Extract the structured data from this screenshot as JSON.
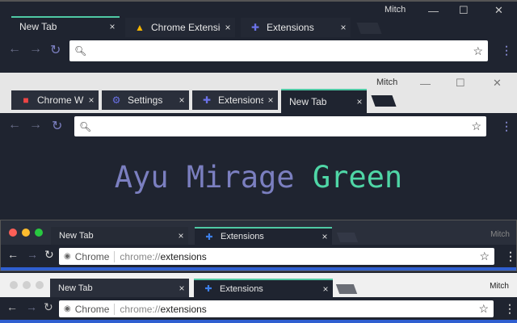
{
  "colors": {
    "frame_dark": "#1f2430",
    "accent_green": "#4fd6a6",
    "accent_purple": "#7b7fc0",
    "blue_strip": "#2f5fd0"
  },
  "window1": {
    "user": "Mitch",
    "tabs": [
      {
        "label": "New Tab",
        "icon": "none"
      },
      {
        "label": "Chrome Extension",
        "icon": "google-drive-icon"
      },
      {
        "label": "Extensions",
        "icon": "puzzle-icon"
      }
    ],
    "close": "×"
  },
  "window2": {
    "user": "Mitch",
    "tabs": [
      {
        "label": "Chrome W",
        "icon": "web-store-icon"
      },
      {
        "label": "Settings",
        "icon": "gear-icon"
      },
      {
        "label": "Extensions",
        "icon": "puzzle-icon"
      },
      {
        "label": "New Tab",
        "icon": "none"
      }
    ],
    "close": "×",
    "headline_a": "Ayu Mirage",
    "headline_b": "Green"
  },
  "window3": {
    "user": "Mitch",
    "tabs": [
      {
        "label": "New Tab"
      },
      {
        "label": "Extensions",
        "icon": "puzzle-icon"
      }
    ],
    "close": "×",
    "site": "Chrome",
    "url_prefix": "chrome://",
    "url_path": "extensions"
  },
  "window4": {
    "user": "Mitch",
    "tabs": [
      {
        "label": "New Tab"
      },
      {
        "label": "Extensions",
        "icon": "puzzle-icon"
      }
    ],
    "close": "×",
    "site": "Chrome",
    "url_prefix": "chrome://",
    "url_path": "extensions"
  }
}
